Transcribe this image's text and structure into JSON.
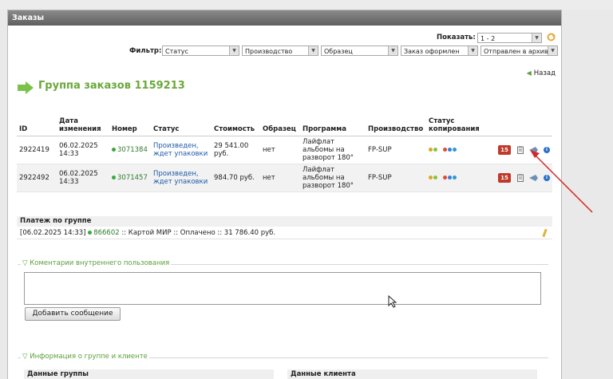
{
  "window": {
    "title": "Заказы"
  },
  "show": {
    "label": "Показать:",
    "value": "1 - 2"
  },
  "filter": {
    "label": "Фильтр:",
    "selects": [
      "Статус",
      "Производство",
      "Образец",
      "Заказ оформлен",
      "Отправлен в архив"
    ]
  },
  "back_label": "Назад",
  "group_title": "Группа заказов 1159213",
  "table": {
    "headers": {
      "id": "ID",
      "date": "Дата изменения",
      "number": "Номер",
      "status": "Статус",
      "price": "Стоимость",
      "sample": "Образец",
      "program": "Программа",
      "production": "Производство",
      "copy_status": "Статус копирования"
    },
    "rows": [
      {
        "id": "2922419",
        "date": "06.02.2025 14:33",
        "number": "3071384",
        "status": "Произведен, ждет упаковки",
        "price": "29 541.00 руб.",
        "sample": "нет",
        "program": "Лайфлат альбомы на разворот 180°",
        "production": "FP-SUP",
        "badge": "15"
      },
      {
        "id": "2922492",
        "date": "06.02.2025 14:33",
        "number": "3071457",
        "status": "Произведен, ждет упаковки",
        "price": "984.70 руб.",
        "sample": "нет",
        "program": "Лайфлат альбомы на разворот 180°",
        "production": "FP-SUP",
        "badge": "15"
      }
    ]
  },
  "payment": {
    "title": "Платеж по группе",
    "date": "[06.02.2025 14:33]",
    "number": "866602",
    "text": ":: Картой МИР :: Оплачено :: 31 786.40 руб."
  },
  "comments": {
    "legend": "Коментарии внутреннего пользования",
    "textarea_value": "",
    "add_button": "Добавить сообщение"
  },
  "info": {
    "legend": "Информация о группе и клиенте",
    "group_data": "Данные группы",
    "client_data": "Данные клиента"
  },
  "colors": {
    "accent_green": "#6aa83a",
    "link_blue": "#1f5aa8",
    "badge_red": "#c0392b",
    "annotation_red": "#d62828"
  }
}
